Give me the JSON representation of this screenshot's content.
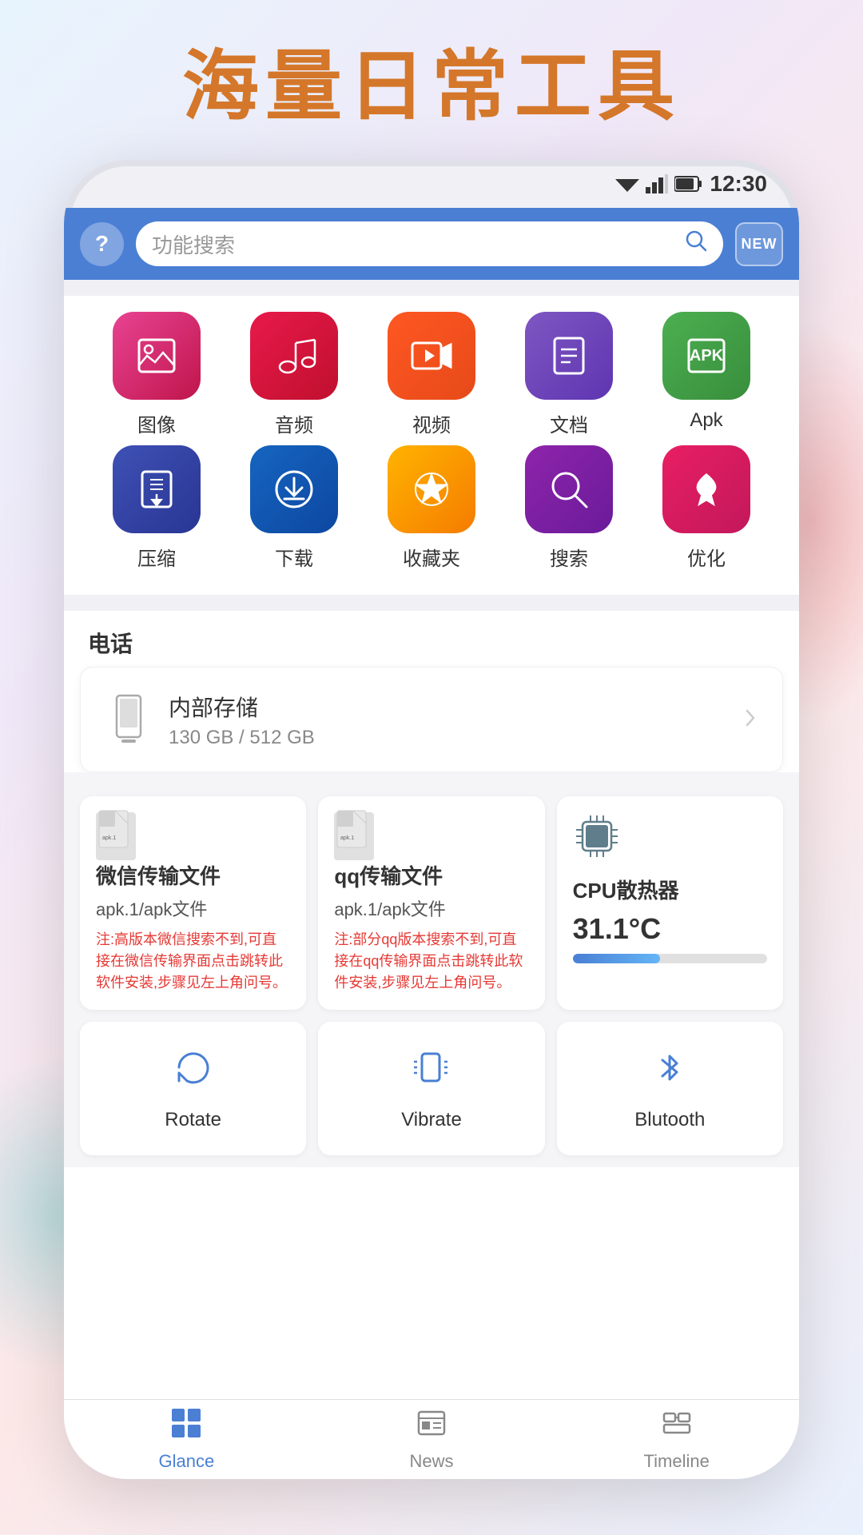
{
  "page": {
    "title": "海量日常工具",
    "background_color": "#f0f0f5"
  },
  "status_bar": {
    "time": "12:30"
  },
  "top_bar": {
    "help_label": "?",
    "search_placeholder": "功能搜索",
    "new_badge_label": "NEW"
  },
  "app_grid": {
    "row1": [
      {
        "id": "image",
        "label": "图像",
        "color_class": "icon-image"
      },
      {
        "id": "audio",
        "label": "音频",
        "color_class": "icon-audio"
      },
      {
        "id": "video",
        "label": "视频",
        "color_class": "icon-video"
      },
      {
        "id": "doc",
        "label": "文档",
        "color_class": "icon-doc"
      },
      {
        "id": "apk",
        "label": "Apk",
        "color_class": "icon-apk"
      }
    ],
    "row2": [
      {
        "id": "compress",
        "label": "压缩",
        "color_class": "icon-compress"
      },
      {
        "id": "download",
        "label": "下载",
        "color_class": "icon-download"
      },
      {
        "id": "favorite",
        "label": "收藏夹",
        "color_class": "icon-favorite"
      },
      {
        "id": "search",
        "label": "搜索",
        "color_class": "icon-search"
      },
      {
        "id": "optimize",
        "label": "优化",
        "color_class": "icon-optimize"
      }
    ]
  },
  "section_phone": {
    "title": "电话"
  },
  "storage": {
    "title": "内部存储",
    "size": "130 GB / 512 GB"
  },
  "widgets": {
    "wechat": {
      "title": "微信传输文件",
      "file_label": "apk.1/apk文件",
      "note": "注:高版本微信搜索不到,可直接在微信传输界面点击跳转此软件安装,步骤见左上角问号。"
    },
    "qq": {
      "title": "qq传输文件",
      "file_label": "apk.1/apk文件",
      "note": "注:部分qq版本搜索不到,可直接在qq传输界面点击跳转此软件安装,步骤见左上角问号。"
    },
    "cpu": {
      "title": "CPU散热器",
      "temp": "31.1°C",
      "bar_percent": 45
    }
  },
  "tools": {
    "rotate": {
      "label": "Rotate"
    },
    "vibrate": {
      "label": "Vibrate"
    },
    "bluetooth": {
      "label": "Blutooth"
    }
  },
  "bottom_nav": {
    "items": [
      {
        "id": "glance",
        "label": "Glance",
        "active": true
      },
      {
        "id": "news",
        "label": "News",
        "active": false
      },
      {
        "id": "timeline",
        "label": "Timeline",
        "active": false
      }
    ]
  }
}
